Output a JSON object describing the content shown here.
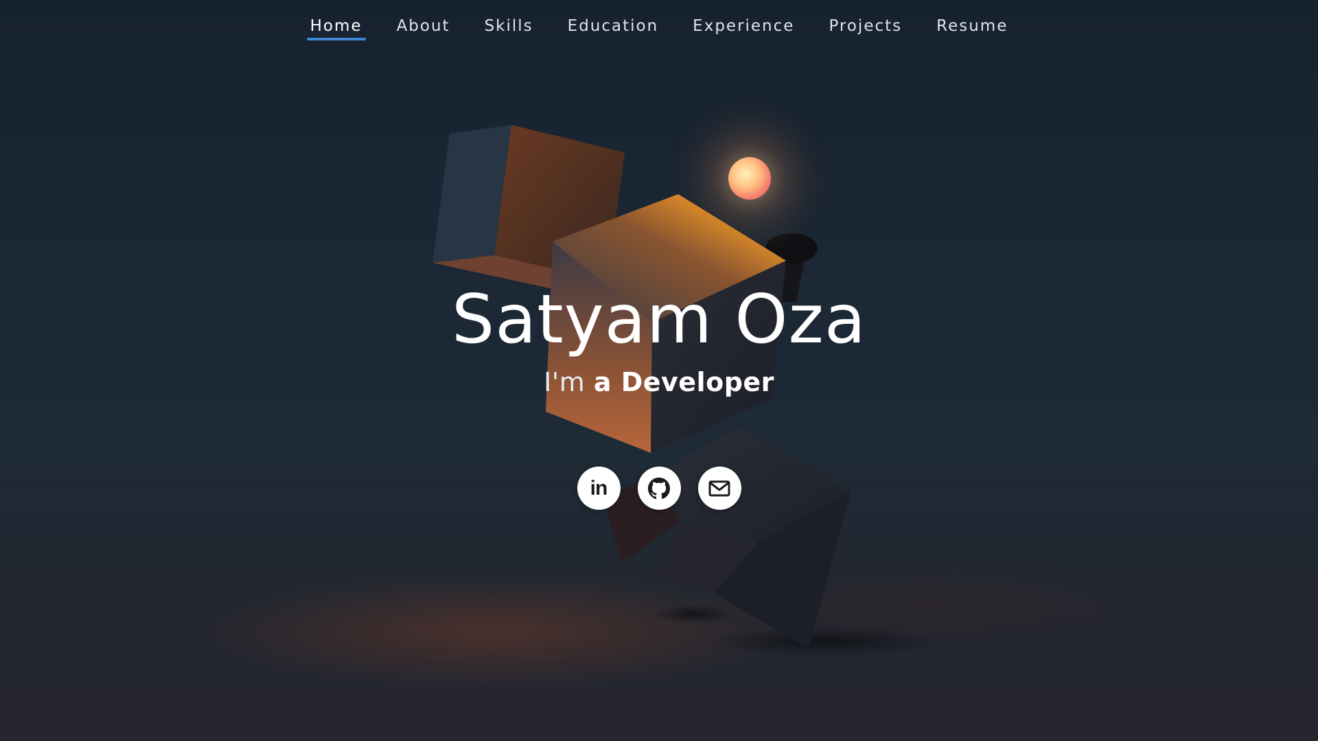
{
  "nav": {
    "items": [
      {
        "label": "Home",
        "active": true
      },
      {
        "label": "About",
        "active": false
      },
      {
        "label": "Skills",
        "active": false
      },
      {
        "label": "Education",
        "active": false
      },
      {
        "label": "Experience",
        "active": false
      },
      {
        "label": "Projects",
        "active": false
      },
      {
        "label": "Resume",
        "active": false
      }
    ],
    "accent_color": "#3f86d4"
  },
  "hero": {
    "name": "Satyam Oza",
    "tagline_prefix": "I'm",
    "tagline_role": "a Developer"
  },
  "social": [
    {
      "name": "linkedin",
      "icon": "linkedin-icon",
      "glyph": "in"
    },
    {
      "name": "github",
      "icon": "github-icon"
    },
    {
      "name": "email",
      "icon": "mail-icon"
    }
  ],
  "colors": {
    "background": "#1a2430",
    "text": "#ffffff",
    "glow": "#f59a2a"
  }
}
